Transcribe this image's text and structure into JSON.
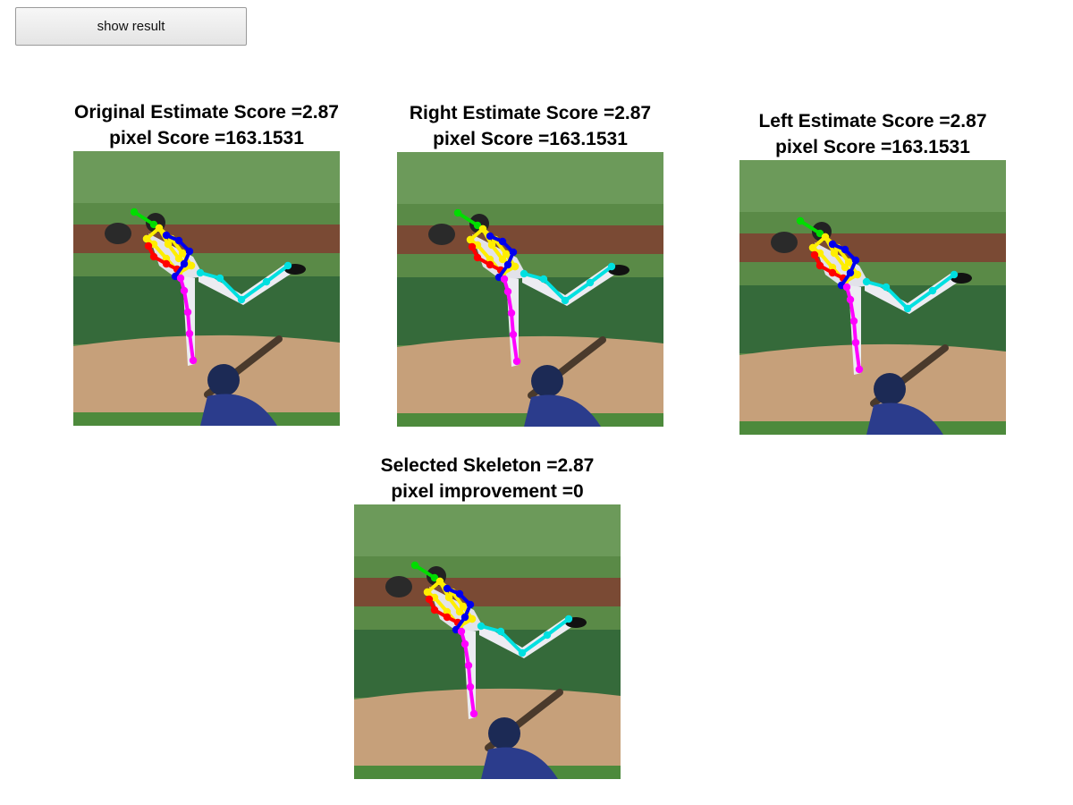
{
  "toolbar": {
    "show_result_label": "show result"
  },
  "panels": [
    {
      "title": "Original Estimate Score =2.87",
      "subtitle": "pixel Score =163.1531"
    },
    {
      "title": "Right Estimate Score =2.87",
      "subtitle": "pixel Score =163.1531"
    },
    {
      "title": "Left Estimate Score =2.87",
      "subtitle": "pixel Score =163.1531"
    },
    {
      "title": "Selected Skeleton =2.87",
      "subtitle": "pixel improvement =0"
    }
  ],
  "colors": {
    "head_limb": "#00dd00",
    "torso": "#ffee00",
    "left_arm": "#ff0000",
    "right_arm": "#0000ee",
    "right_leg": "#00e0e0",
    "left_leg": "#ff00ff"
  }
}
